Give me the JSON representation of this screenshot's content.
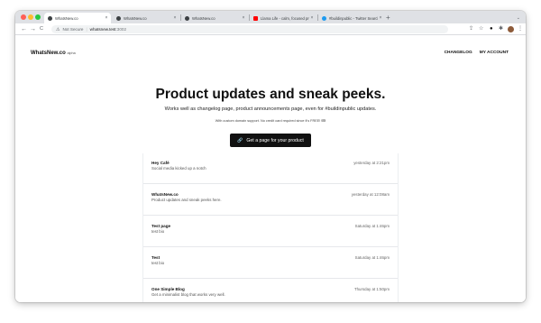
{
  "browser": {
    "tabs": [
      {
        "title": "WhatsNew.co",
        "active": true,
        "favicon_color": "#3c4043"
      },
      {
        "title": "WhatsNew.co",
        "active": false,
        "favicon_color": "#3c4043"
      },
      {
        "title": "WhatsNew.co",
        "active": false,
        "favicon_color": "#3c4043"
      },
      {
        "title": "Llama Life - calm, focused pro",
        "active": false,
        "favicon_color": "#ff0000"
      },
      {
        "title": "#buildinpublic - Twitter Search",
        "active": false,
        "favicon_color": "#1d9bf0"
      }
    ],
    "tab_close": "×",
    "new_tab": "+",
    "tab_menu": "⌄",
    "nav": {
      "back": "←",
      "forward": "→",
      "reload": "C"
    },
    "address": {
      "warning_icon": "warning-triangle-icon",
      "security_label": "Not Secure",
      "host": "whatsnew.test",
      "port": ":3002"
    },
    "toolbar_icons": [
      "share-icon",
      "star-icon",
      "extension-icon",
      "puzzle-icon",
      "avatar",
      "kebab-menu-icon"
    ]
  },
  "site": {
    "logo": "WhatsNew.co",
    "logo_badge": "alpha",
    "nav": {
      "changelog": "CHANGELOG",
      "account": "MY ACCOUNT"
    },
    "hero": {
      "title": "Product updates and sneak peeks.",
      "subtitle": "Works well as changelog page, product announcements page, even for #buildinpublic updates.",
      "note": "With custom domain support. No credit card required since it's FREE! 🎟"
    },
    "cta": {
      "label": "Get a page for your product",
      "icon": "link-icon"
    },
    "posts": [
      {
        "title": "Hey Café",
        "description": "Social media kicked up a notch",
        "time": "yesterday at 2:21pm"
      },
      {
        "title": "WhatsNew.co",
        "description": "Product updates and sneak peeks here.",
        "time": "yesterday at 12:08am"
      },
      {
        "title": "Test page",
        "description": "test bio",
        "time": "Saturday at 1:46pm"
      },
      {
        "title": "Test",
        "description": "test bio",
        "time": "Saturday at 1:46pm"
      },
      {
        "title": "One Simple Blog",
        "description": "Get a minimalist blog that works very well.",
        "time": "Thursday at 1:50pm"
      }
    ]
  },
  "colors": {
    "accent": "#111111",
    "page_bg": "#ffffff",
    "tabstrip_bg": "#dfe1e5"
  }
}
